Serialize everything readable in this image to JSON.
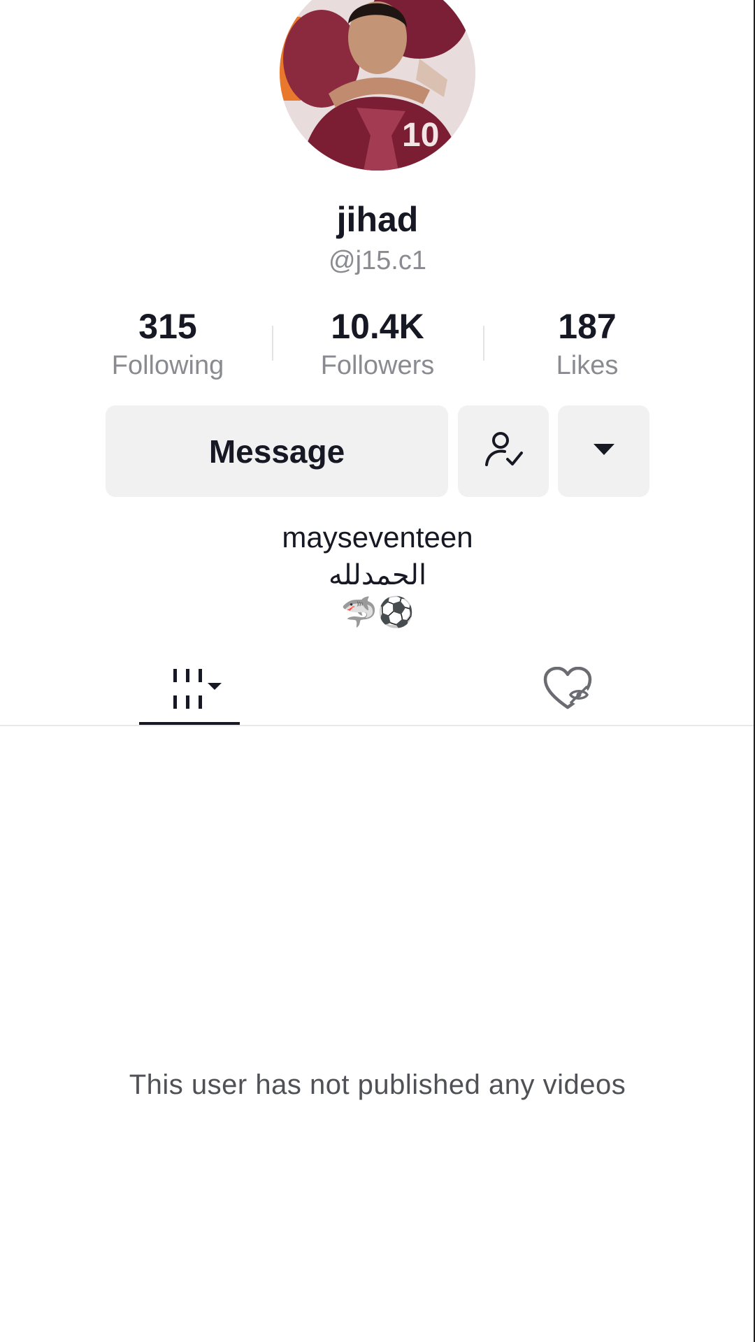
{
  "profile": {
    "display_name": "jihad",
    "username": "@j15.c1",
    "avatar_icon": "profile-photo"
  },
  "stats": {
    "following": {
      "value": "315",
      "label": "Following"
    },
    "followers": {
      "value": "10.4K",
      "label": "Followers"
    },
    "likes": {
      "value": "187",
      "label": "Likes"
    }
  },
  "actions": {
    "message_label": "Message",
    "following_icon": "user-check-icon",
    "more_icon": "caret-down-icon"
  },
  "bio": {
    "line1": "mayseventeen",
    "line2": "الحمدلله",
    "line3": "🦈⚽"
  },
  "tabs": {
    "videos_icon": "grid-icon",
    "liked_icon": "liked-hidden-icon"
  },
  "empty_state": {
    "message": "This user has not published any videos"
  },
  "colors": {
    "text_primary": "#161823",
    "text_secondary": "#8a8b91",
    "button_bg": "#f1f1f2"
  }
}
